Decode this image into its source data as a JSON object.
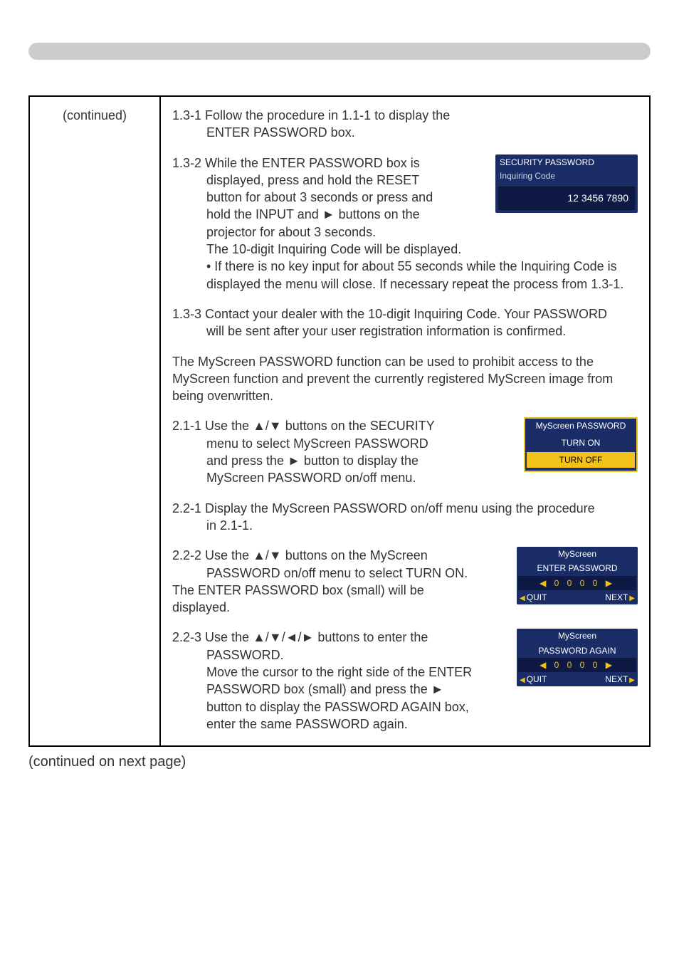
{
  "left_col": "(continued)",
  "footer": "(continued on next page)",
  "s131": {
    "head": "1.3-1 Follow the procedure in 1.1-1 to display the",
    "line2": "ENTER PASSWORD box."
  },
  "s132": {
    "head": "1.3-2 While the ENTER PASSWORD box is",
    "l2": "displayed, press and hold the RESET",
    "l3": "button for about 3 seconds or press and",
    "l4": "hold the INPUT and ► buttons on the",
    "l5": "projector for about 3 seconds.",
    "l6": "The 10-digit Inquiring Code will be displayed.",
    "bullet": "• If there is no key input for about 55 seconds while the Inquiring Code is displayed the menu will close. If necessary repeat the process from 1.3-1."
  },
  "inquiring_box": {
    "title": "SECURITY PASSWORD",
    "sub": "Inquiring Code",
    "code": "12 3456 7890"
  },
  "s133": {
    "head": "1.3-3 Contact your dealer with the 10-digit Inquiring Code. Your PASSWORD",
    "l2": "will be sent after your user registration information is confirmed."
  },
  "intro2": "The MyScreen PASSWORD function can be used to prohibit access to the MyScreen function and prevent the currently registered MyScreen image from being overwritten.",
  "s211": {
    "head": "2.1-1 Use the ▲/▼ buttons on the SECURITY",
    "l2": "menu to select MyScreen PASSWORD",
    "l3": "and press the ► button to display the",
    "l4": "MyScreen PASSWORD on/off menu."
  },
  "onoff_box": {
    "title": "MyScreen PASSWORD",
    "opt_on": "TURN ON",
    "opt_off": "TURN OFF"
  },
  "s221": {
    "head": "2.2-1 Display the MyScreen PASSWORD on/off menu using the procedure",
    "l2": "in 2.1-1."
  },
  "s222": {
    "head": "2.2-2 Use the ▲/▼ buttons on the MyScreen",
    "l2": "PASSWORD on/off menu to select TURN ON.",
    "l3": "The ENTER PASSWORD box (small) will be",
    "l4": "displayed."
  },
  "enter_box": {
    "title1": "MyScreen",
    "title2": "ENTER PASSWORD",
    "digits": "0 0 0 0",
    "quit": "QUIT",
    "next": "NEXT"
  },
  "s223": {
    "head": "2.2-3 Use the ▲/▼/◄/► buttons to enter the",
    "l2": "PASSWORD.",
    "l3": "Move the cursor to the right side of the ENTER",
    "l4": "PASSWORD box (small) and press the ►",
    "l5": "button to display the PASSWORD AGAIN box,",
    "l6": "enter the same PASSWORD again."
  },
  "again_box": {
    "title1": "MyScreen",
    "title2": "PASSWORD AGAIN",
    "digits": "0 0 0 0",
    "quit": "QUIT",
    "next": "NEXT"
  }
}
